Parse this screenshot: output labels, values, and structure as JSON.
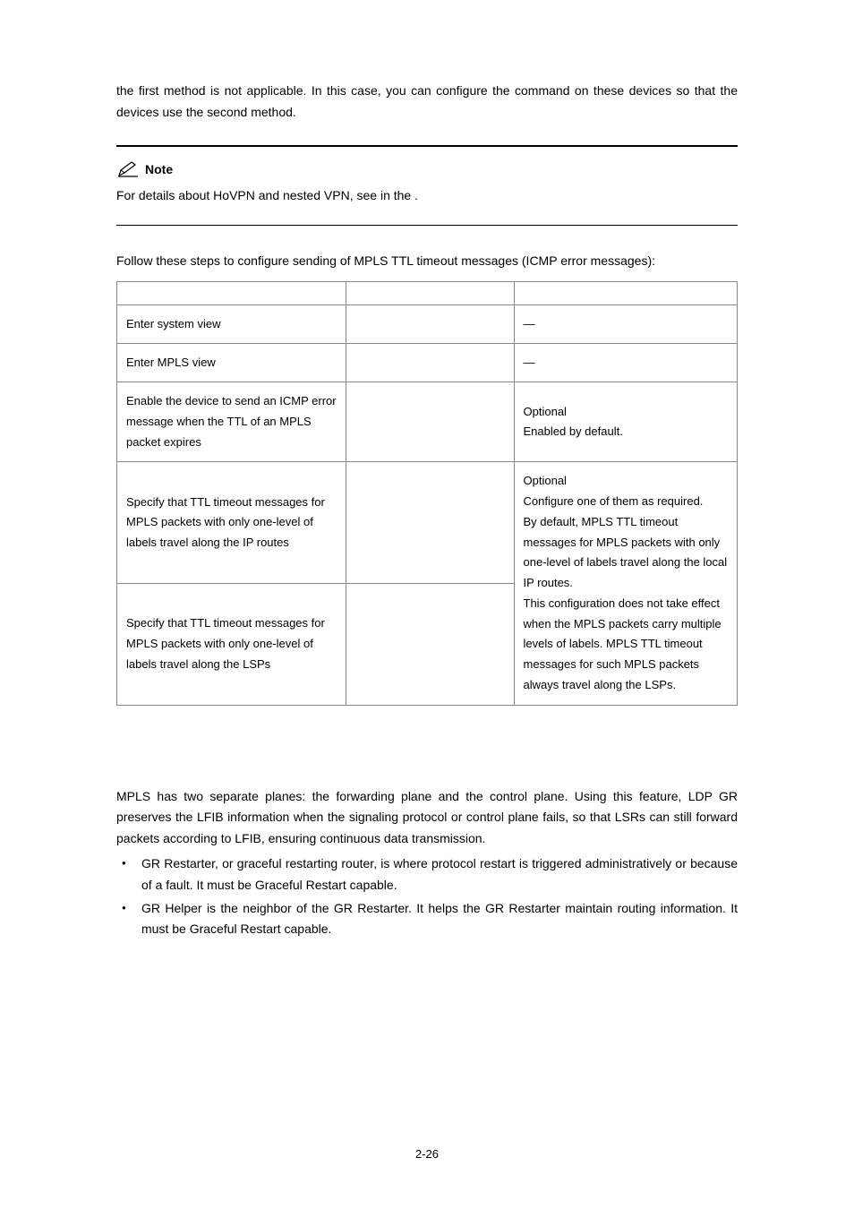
{
  "intro_para": "the first method is not applicable. In this case, you can configure the command on these devices so that the devices use the second method.",
  "note": {
    "label": "Note",
    "body_prefix": "For details about HoVPN and nested VPN, see ",
    "body_suffix_text": " in the ",
    "body_end": "."
  },
  "steps_intro": "Follow these steps to configure sending of MPLS TTL timeout messages (ICMP error messages):",
  "table": {
    "rows": [
      {
        "c1": "Enter system view",
        "c2": "",
        "c3": "—"
      },
      {
        "c1": "Enter MPLS view",
        "c2": "",
        "c3": "—"
      },
      {
        "c1": "Enable the device to send an ICMP error message when the TTL of an MPLS packet expires",
        "c2": "",
        "c3": "Optional\nEnabled by default."
      },
      {
        "c1": "Specify that TTL timeout messages for MPLS packets with only one-level of labels travel along the IP routes",
        "c2": ""
      },
      {
        "c1": "Specify that TTL timeout messages for MPLS packets with only one-level of labels travel along the LSPs",
        "c2": ""
      }
    ],
    "merged_remarks": "Optional\nConfigure one of them as required.\nBy default, MPLS TTL timeout messages for MPLS packets with only one-level of labels travel along the local IP routes.\nThis configuration does not take effect when the MPLS packets carry multiple levels of labels. MPLS TTL timeout messages for such MPLS packets always travel along the LSPs."
  },
  "section2_para": "MPLS has two separate planes: the forwarding plane and the control plane. Using this feature, LDP GR preserves the LFIB information when the signaling protocol or control plane fails, so that LSRs can still forward packets according to LFIB, ensuring continuous data transmission.",
  "bullets": [
    "GR Restarter, or graceful restarting router, is where protocol restart is triggered administratively or because of a fault. It must be Graceful Restart capable.",
    "GR Helper is the neighbor of the GR Restarter. It helps the GR Restarter maintain routing information. It must be Graceful Restart capable."
  ],
  "page_number": "2-26"
}
